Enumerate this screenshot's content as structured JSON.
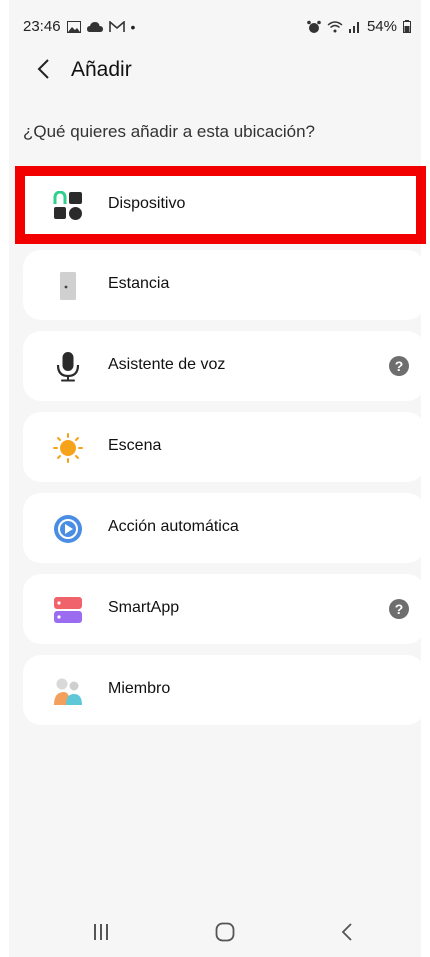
{
  "status_bar": {
    "time": "23:46",
    "battery": "54%"
  },
  "app_bar": {
    "title": "Añadir"
  },
  "question": "¿Qué quieres añadir a esta ubicación?",
  "items": [
    {
      "label": "Dispositivo",
      "icon": "devices-icon",
      "help": false
    },
    {
      "label": "Estancia",
      "icon": "room-door-icon",
      "help": false
    },
    {
      "label": "Asistente de voz",
      "icon": "microphone-icon",
      "help": true
    },
    {
      "label": "Escena",
      "icon": "sun-scene-icon",
      "help": false
    },
    {
      "label": "Acción automática",
      "icon": "automation-play-icon",
      "help": false
    },
    {
      "label": "SmartApp",
      "icon": "smartapp-icon",
      "help": true
    },
    {
      "label": "Miembro",
      "icon": "members-icon",
      "help": false
    }
  ],
  "help_glyph": "?",
  "colors": {
    "highlight": "#f20000",
    "background": "#f6f6f6",
    "card": "#ffffff"
  }
}
